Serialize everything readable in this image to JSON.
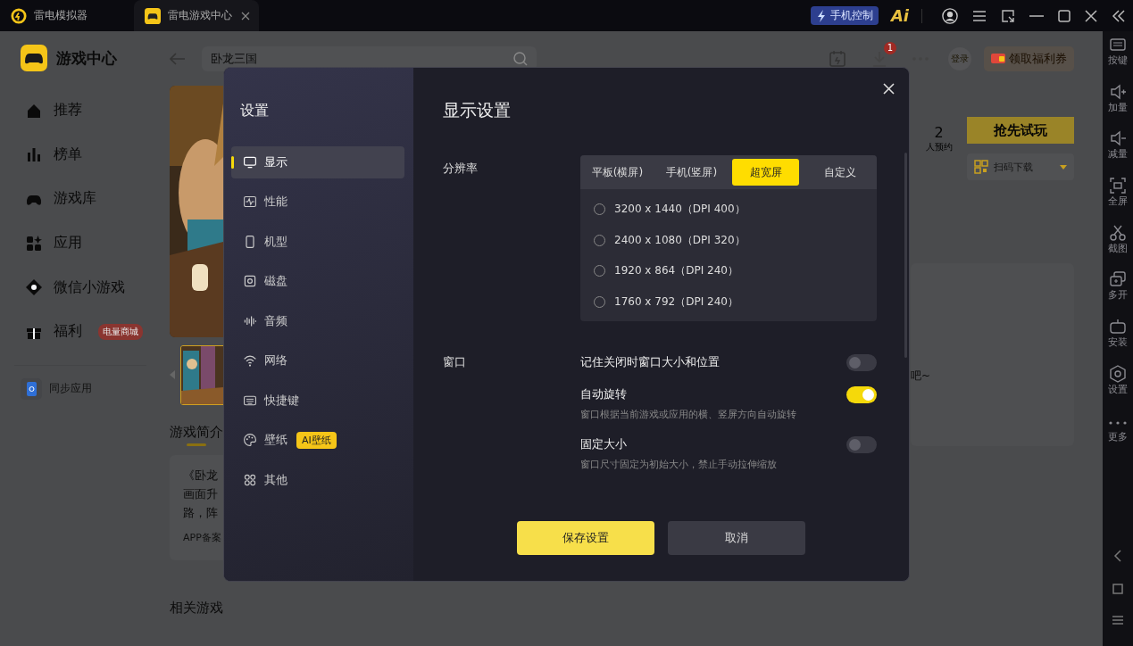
{
  "title_bar": {
    "tabs": [
      {
        "label": "雷电模拟器",
        "selected": false
      },
      {
        "label": "雷电游戏中心",
        "selected": true
      }
    ],
    "phone_control": "手机控制",
    "ai_logo": "Ai"
  },
  "app": {
    "name": "游戏中心",
    "nav": [
      {
        "label": "推荐"
      },
      {
        "label": "榜单"
      },
      {
        "label": "游戏库"
      },
      {
        "label": "应用"
      },
      {
        "label": "微信小游戏"
      },
      {
        "label": "福利",
        "badge": "电量商城"
      }
    ],
    "sync": "同步应用"
  },
  "search": {
    "value": "卧龙三国"
  },
  "header": {
    "download_badge": "1",
    "login": "登录",
    "coupon": "领取福利券"
  },
  "game": {
    "reservations": "2",
    "reservations_label": "人预约",
    "trial_button": "抢先试玩",
    "scan_download": "扫码下载",
    "intro_title": "游戏简介",
    "intro_lines": [
      "《卧龙",
      "画面升",
      "路，阵"
    ],
    "filing": "APP备案",
    "side_text": "吧~",
    "related_title": "相关游戏"
  },
  "side_toolbar": [
    "按键",
    "加量",
    "减量",
    "全屏",
    "截图",
    "多开",
    "安装",
    "设置",
    "更多"
  ],
  "dialog": {
    "sidebar_title": "设置",
    "menu": [
      {
        "label": "显示",
        "selected": true
      },
      {
        "label": "性能",
        "selected": false
      },
      {
        "label": "机型",
        "selected": false
      },
      {
        "label": "磁盘",
        "selected": false
      },
      {
        "label": "音频",
        "selected": false
      },
      {
        "label": "网络",
        "selected": false
      },
      {
        "label": "快捷键",
        "selected": false
      },
      {
        "label": "壁纸",
        "selected": false,
        "badge": "AI壁纸"
      },
      {
        "label": "其他",
        "selected": false
      }
    ],
    "title": "显示设置",
    "resolution": {
      "label": "分辨率",
      "tabs": [
        {
          "label": "平板(横屏)",
          "selected": false
        },
        {
          "label": "手机(竖屏)",
          "selected": false
        },
        {
          "label": "超宽屏",
          "selected": true
        },
        {
          "label": "自定义",
          "selected": false
        }
      ],
      "options": [
        {
          "label": "3200 x 1440（DPI 400）",
          "selected": false
        },
        {
          "label": "2400 x 1080（DPI 320）",
          "selected": false
        },
        {
          "label": "1920 x 864（DPI 240）",
          "selected": false
        },
        {
          "label": "1760 x 792（DPI 240）",
          "selected": false
        }
      ]
    },
    "window": {
      "label": "窗口",
      "settings": [
        {
          "label": "记住关闭时窗口大小和位置",
          "on": false
        },
        {
          "label": "自动旋转",
          "on": true,
          "description": "窗口根据当前游戏或应用的横、竖屏方向自动旋转"
        },
        {
          "label": "固定大小",
          "on": false,
          "description": "窗口尺寸固定为初始大小，禁止手动拉伸缩放"
        }
      ]
    },
    "buttons": {
      "save": "保存设置",
      "cancel": "取消"
    }
  }
}
